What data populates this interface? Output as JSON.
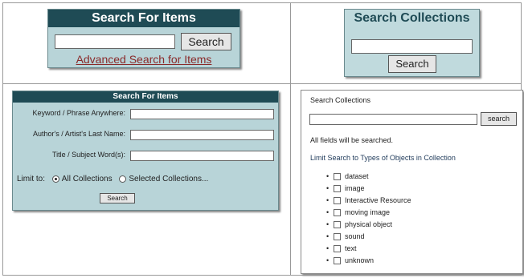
{
  "panel_simple_items": {
    "title": "Search For Items",
    "button": "Search",
    "link": "Advanced Search for Items"
  },
  "panel_simple_collections": {
    "title": "Search Collections",
    "button": "Search"
  },
  "panel_advanced_items": {
    "title": "Search For Items",
    "fields": [
      {
        "label": "Keyword / Phrase Anywhere:"
      },
      {
        "label": "Author's / Artist's Last Name:"
      },
      {
        "label": "Title / Subject Word(s):"
      }
    ],
    "limit_label": "Limit to:",
    "radio_all": "All Collections",
    "radio_selected": "Selected Collections...",
    "button": "Search"
  },
  "panel_advanced_collections": {
    "title": "Search Collections",
    "button": "search",
    "note": "All fields will be searched.",
    "limit_heading": "Limit Search to Types of Objects in Collection",
    "types": [
      "dataset",
      "image",
      "Interactive Resource",
      "moving image",
      "physical object",
      "sound",
      "text",
      "unknown"
    ]
  }
}
